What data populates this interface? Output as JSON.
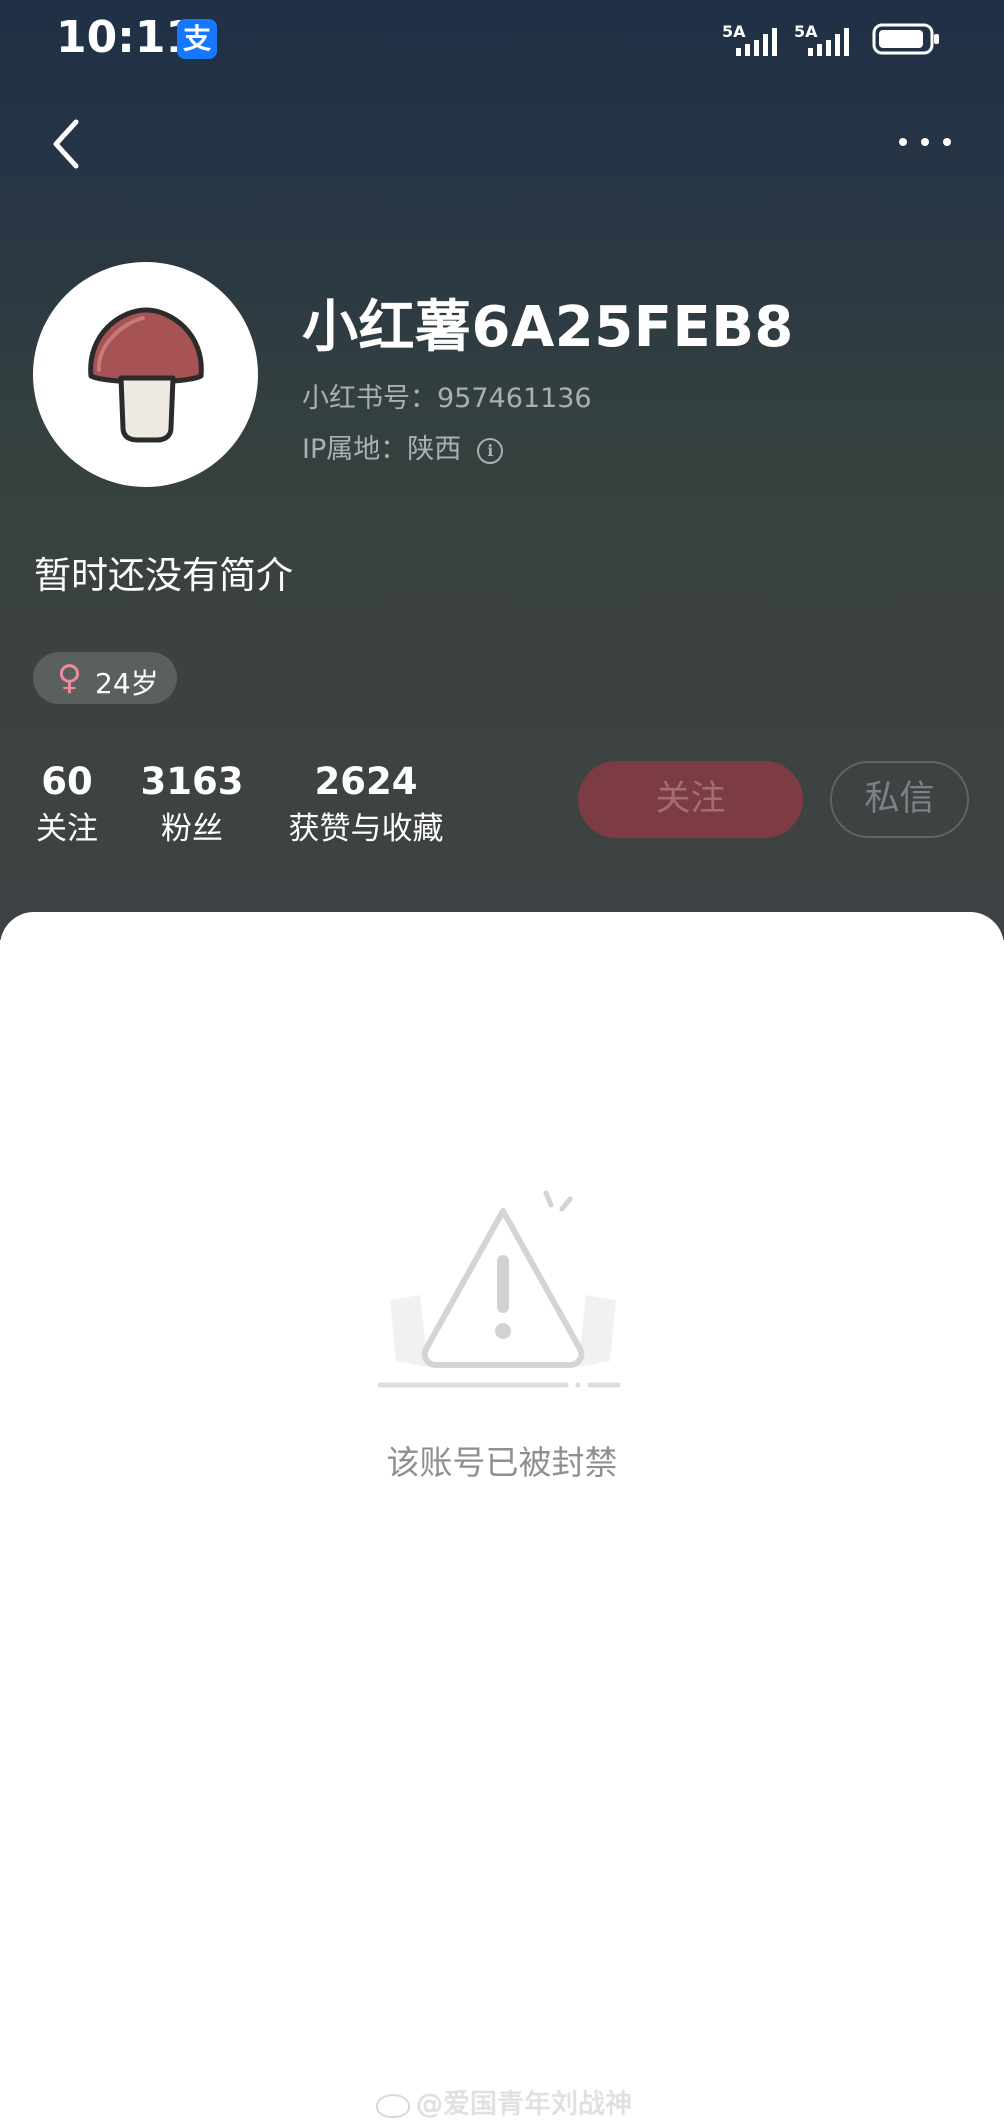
{
  "status_bar": {
    "time": "10:11",
    "alipay_icon": "支",
    "signal_1_label": "5A",
    "signal_2_label": "5A"
  },
  "header": {
    "back_icon": "chevron-left-icon",
    "more_icon": "more-dots-icon"
  },
  "profile": {
    "avatar_icon": "mushroom-icon",
    "username": "小红薯6A25FEB8",
    "id_label": "小红书号：957461136",
    "ip_label": "IP属地：陕西",
    "info_icon_text": "i",
    "bio": "暂时还没有简介",
    "gender_icon": "♀",
    "age": "24岁"
  },
  "stats": [
    {
      "value": "60",
      "label": "关注"
    },
    {
      "value": "3163",
      "label": "粉丝"
    },
    {
      "value": "2624",
      "label": "获赞与收藏"
    }
  ],
  "actions": {
    "follow_label": "关注",
    "message_label": "私信"
  },
  "content": {
    "warning_icon": "warning-triangle-icon",
    "banned_message": "该账号已被封禁"
  },
  "watermark": {
    "text": "@爱国青年刘战神",
    "icon": "weibo-icon"
  },
  "colors": {
    "header_top": "#1f3047",
    "header_bottom": "#3f4244",
    "follow_button": "#7d3c43",
    "female_pink": "#ef8a9c"
  }
}
